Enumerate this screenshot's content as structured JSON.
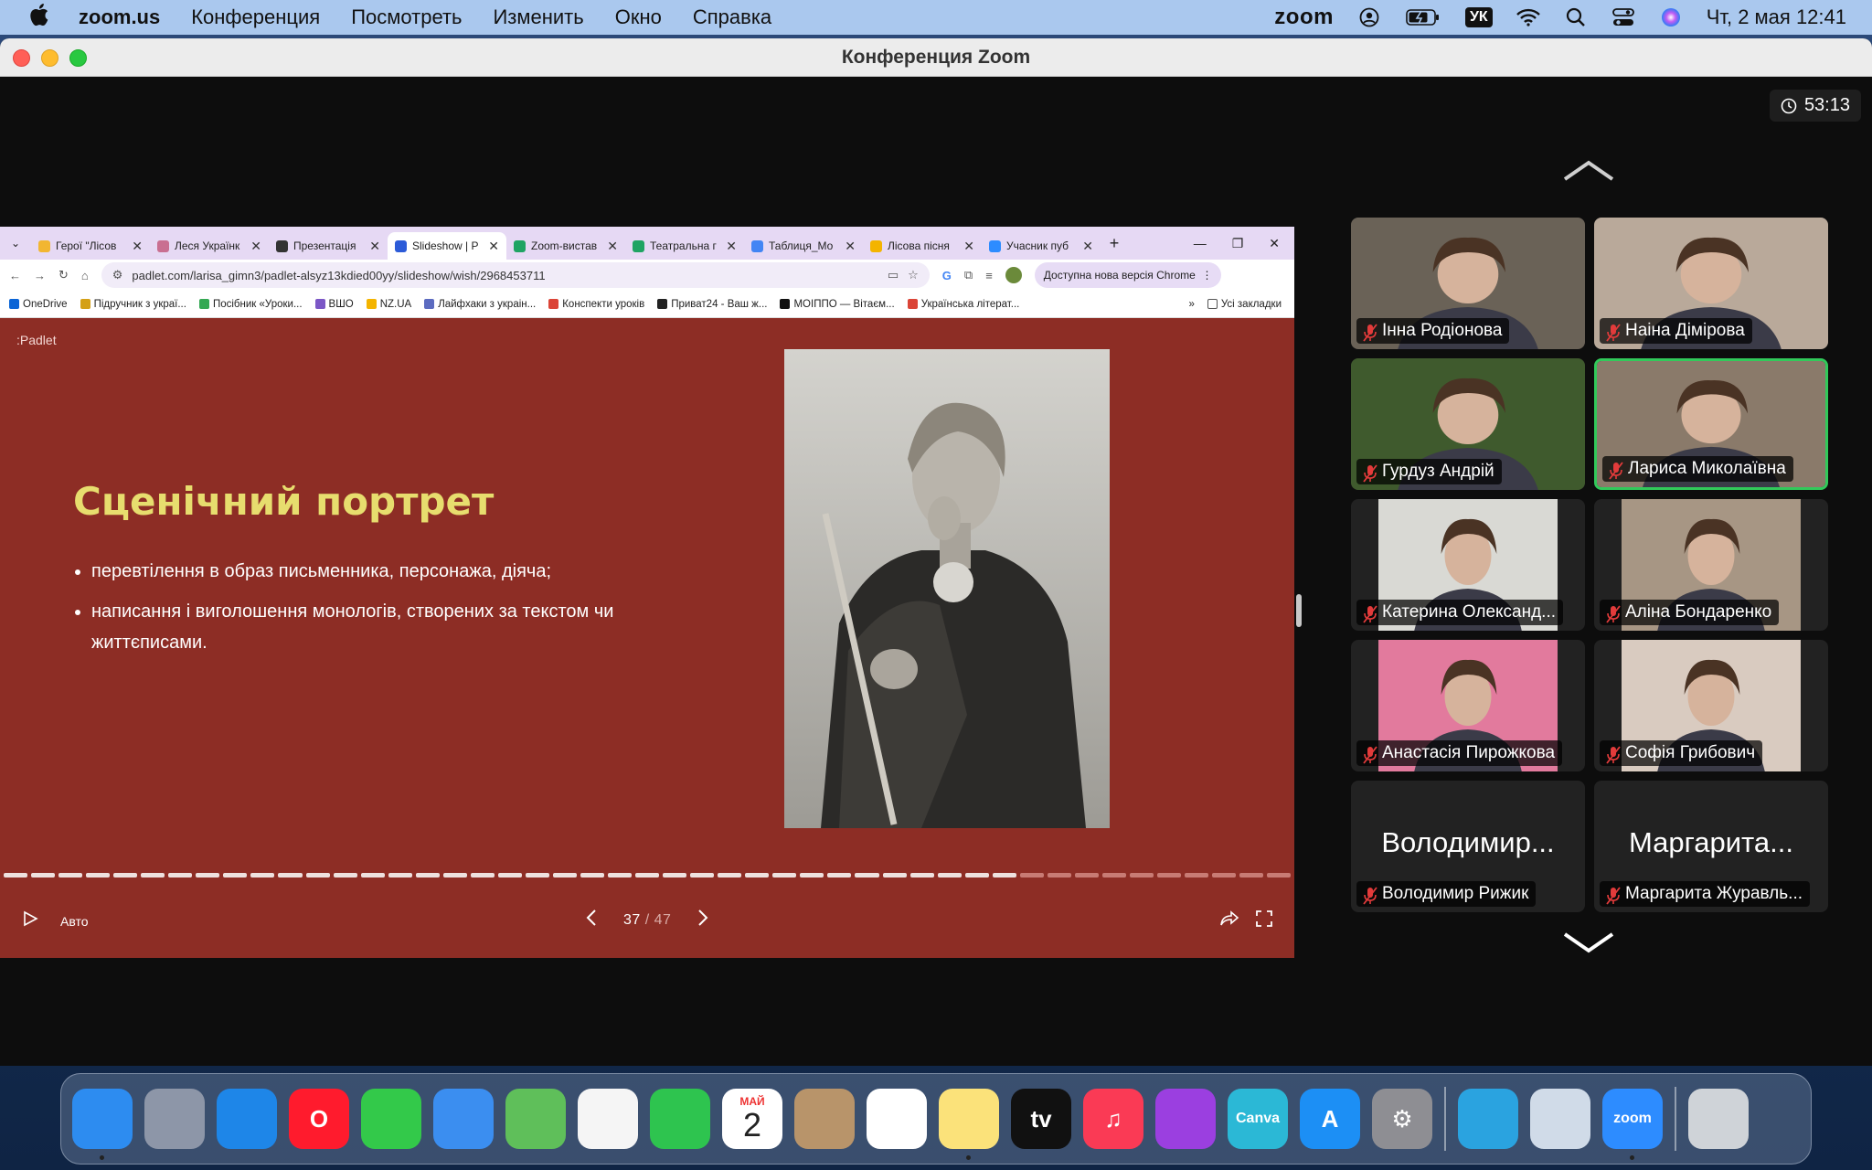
{
  "menubar": {
    "app": "zoom.us",
    "items": [
      "Конференция",
      "Посмотреть",
      "Изменить",
      "Окно",
      "Справка"
    ],
    "zoom_logo": "zoom",
    "lang": "УК",
    "datetime": "Чт, 2 мая  12:41"
  },
  "window": {
    "title": "Конференция Zoom",
    "timer": "53:13"
  },
  "chrome": {
    "tabs": [
      {
        "label": "Герої \"Лісов",
        "color": "#f2b631",
        "active": false
      },
      {
        "label": "Леся Українк",
        "color": "#c96f91",
        "active": false
      },
      {
        "label": "Презентація",
        "color": "#333333",
        "active": false
      },
      {
        "label": "Slideshow | P",
        "color": "#2c5bd8",
        "active": true
      },
      {
        "label": "Zoom-вистав",
        "color": "#1fa463",
        "active": false
      },
      {
        "label": "Театральна г",
        "color": "#1fa463",
        "active": false
      },
      {
        "label": "Таблиця_Мо",
        "color": "#4285f4",
        "active": false
      },
      {
        "label": "Лісова пісня",
        "color": "#f4b400",
        "active": false
      },
      {
        "label": "Учасник пуб",
        "color": "#2d8cff",
        "active": false
      }
    ],
    "url": "padlet.com/larisa_gimn3/padlet-alsyz13kdied00yy/slideshow/wish/2968453711",
    "update_label": "Доступна нова версія Chrome",
    "bookmarks": [
      {
        "label": "OneDrive",
        "color": "#0a64d6"
      },
      {
        "label": "Підручник з украї...",
        "color": "#d4a017"
      },
      {
        "label": "Посібник «Уроки...",
        "color": "#34a853"
      },
      {
        "label": "ВШО",
        "color": "#7b57c6"
      },
      {
        "label": "NZ.UA",
        "color": "#f4b400"
      },
      {
        "label": "Лайфхаки з украін...",
        "color": "#5c6bc0"
      },
      {
        "label": "Конспекти уроків",
        "color": "#db4437"
      },
      {
        "label": "Приват24 - Ваш ж...",
        "color": "#222222"
      },
      {
        "label": "МОІППО — Вітаєм...",
        "color": "#111111"
      },
      {
        "label": "Українська літерат...",
        "color": "#db4437"
      }
    ],
    "all_bookmarks": "Усі закладки"
  },
  "slide": {
    "logo": ":Padlet",
    "title": "Сценічний портрет",
    "bullets": [
      "перевтілення в образ письменника, персонажа, діяча;",
      "написання і виголошення монологів, створених за текстом чи життєписами."
    ],
    "auto_label": "Авто",
    "current": "37",
    "total": "/ 47",
    "progress_current": 37,
    "progress_total": 47
  },
  "participants": [
    {
      "name": "Інна Родіонова",
      "bg": "#6a6257",
      "active": false
    },
    {
      "name": "Наіна Дімірова",
      "bg": "#b9a99a",
      "active": false
    },
    {
      "name": "Гурдуз Андрій",
      "bg": "#3f5a2d",
      "active": false
    },
    {
      "name": "Лариса Миколаївна",
      "bg": "#8a7a6a",
      "active": true
    },
    {
      "name": "Катерина Олександ...",
      "bg": "#d9d9d4",
      "active": false
    },
    {
      "name": "Аліна Бондаренко",
      "bg": "#a79684",
      "active": false
    },
    {
      "name": "Анастасія Пирожкова",
      "bg": "#e27a9d",
      "active": false
    },
    {
      "name": "Софія Грибович",
      "bg": "#d9cbc0",
      "active": false
    },
    {
      "name": "Володимир Рижик",
      "display": "Володимир...",
      "bg": "#232323",
      "active": false
    },
    {
      "name": "Маргарита Журавль...",
      "display": "Маргарита...",
      "bg": "#232323",
      "active": false
    }
  ],
  "dock": [
    {
      "name": "finder",
      "label": "",
      "color": "#2d8cf0"
    },
    {
      "name": "launchpad",
      "label": "",
      "color": "#8d96a8"
    },
    {
      "name": "safari",
      "label": "",
      "color": "#1e86e8"
    },
    {
      "name": "opera",
      "label": "O",
      "color": "#ff1b2d"
    },
    {
      "name": "messages",
      "label": "",
      "color": "#33c94a"
    },
    {
      "name": "mail",
      "label": "",
      "color": "#3b8ef0"
    },
    {
      "name": "maps",
      "label": "",
      "color": "#5fbf5a"
    },
    {
      "name": "photos",
      "label": "",
      "color": "#f5f5f5"
    },
    {
      "name": "facetime",
      "label": "",
      "color": "#2ec44f"
    },
    {
      "name": "calendar",
      "label": "2",
      "month": "МАЙ",
      "color": "#ffffff"
    },
    {
      "name": "contacts",
      "label": "",
      "color": "#b8946a"
    },
    {
      "name": "reminders",
      "label": "",
      "color": "#ffffff"
    },
    {
      "name": "notes",
      "label": "",
      "color": "#fbe27a"
    },
    {
      "name": "apple-tv",
      "label": "tv",
      "color": "#111111"
    },
    {
      "name": "music",
      "label": "♫",
      "color": "#fa3a55"
    },
    {
      "name": "podcasts",
      "label": "",
      "color": "#9b3fe0"
    },
    {
      "name": "canva",
      "label": "Canva",
      "color": "#2bb8d6"
    },
    {
      "name": "app-store",
      "label": "A",
      "color": "#1c8ff5"
    },
    {
      "name": "system-settings",
      "label": "⚙",
      "color": "#8e8e93"
    },
    {
      "name": "telegram",
      "label": "",
      "color": "#2aa3e0"
    },
    {
      "name": "preview",
      "label": "",
      "color": "#d0dbe8"
    },
    {
      "name": "zoom",
      "label": "zoom",
      "color": "#2d8cff"
    },
    {
      "name": "trash",
      "label": "",
      "color": "#cfd3d8"
    }
  ]
}
